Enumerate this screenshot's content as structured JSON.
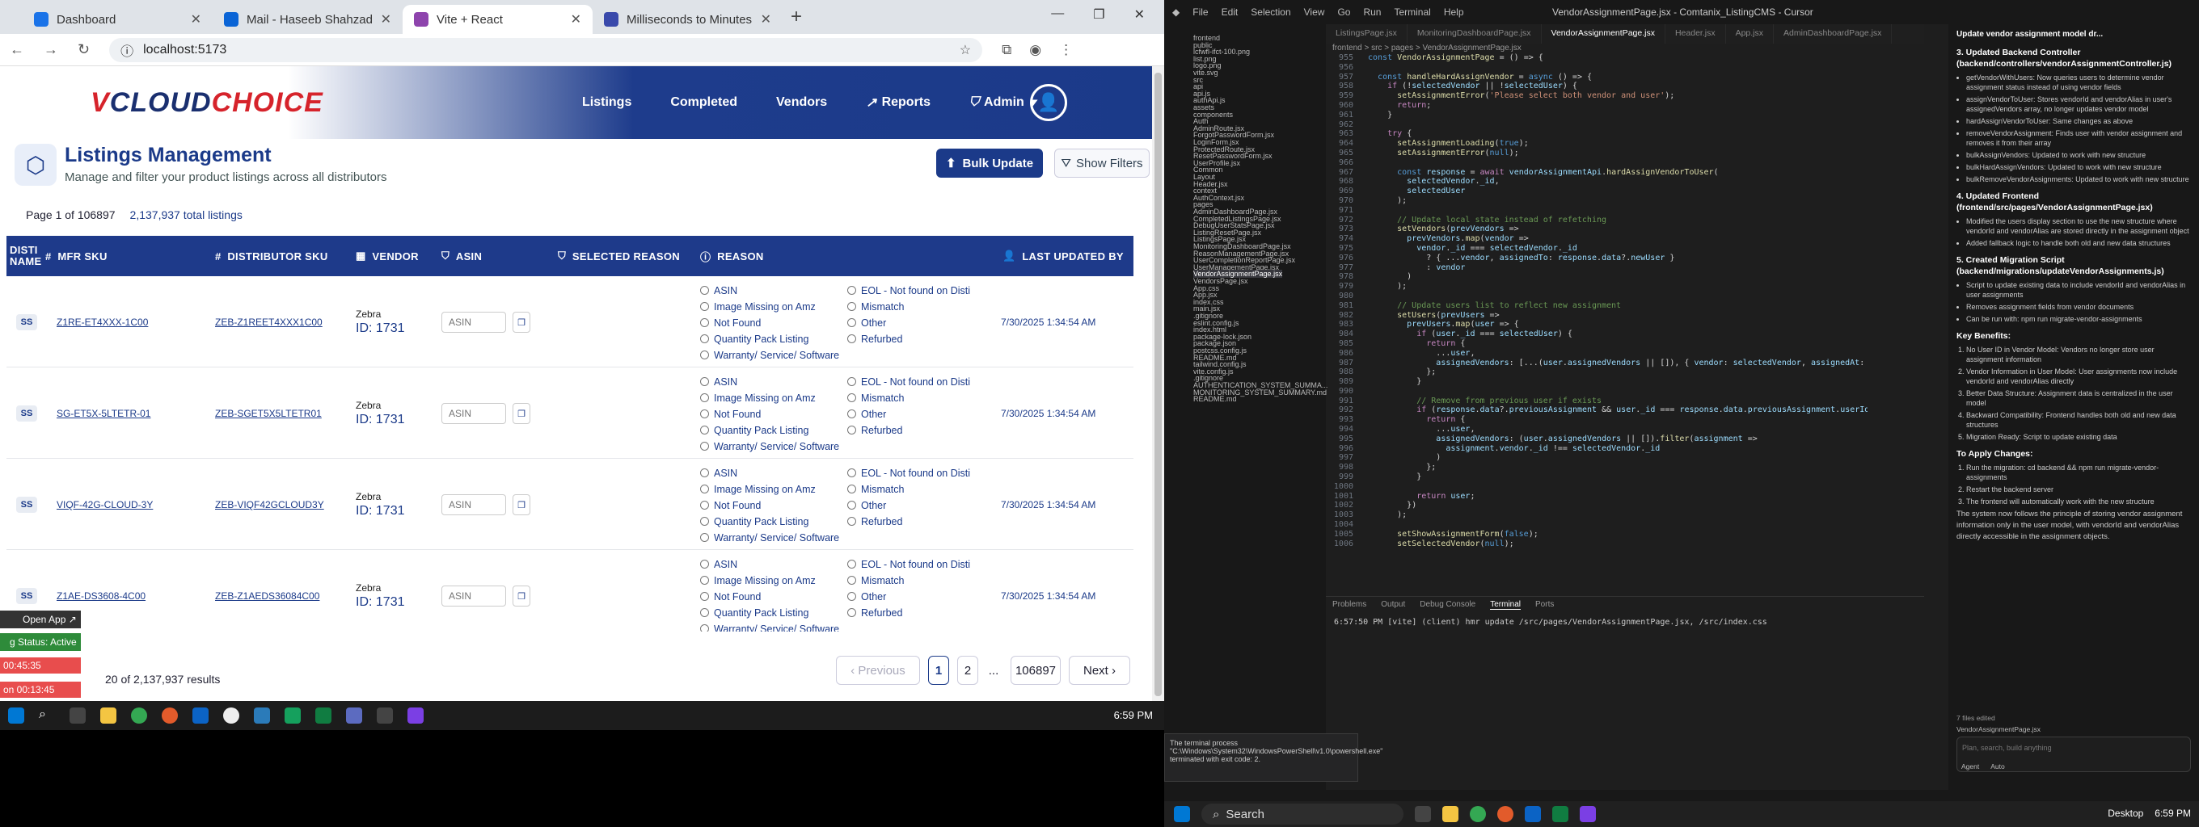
{
  "browser": {
    "tabs": [
      {
        "label": "Dashboard",
        "color": "#1a73e8"
      },
      {
        "label": "Mail - Haseeb Shahzad - Outlo",
        "color": "#0a64d6"
      },
      {
        "label": "Vite + React",
        "color": "#8e44ad"
      },
      {
        "label": "Milliseconds to Minutes | Conv",
        "color": "#3949ab"
      }
    ],
    "url": "localhost:5173"
  },
  "app": {
    "logo_v": "V",
    "logo_cloud": "CLOUD",
    "logo_choice": "CHOICE",
    "nav": [
      "Listings",
      "Completed",
      "Vendors",
      "Reports",
      "Admin"
    ],
    "title": "Listings Management",
    "subtitle": "Manage and filter your product listings across all distributors",
    "bulk_label": "Bulk Update",
    "filters_label": "Show Filters",
    "page_of": "Page 1 of 106897",
    "total": "2,137,937 total listings"
  },
  "table": {
    "headers": [
      "DISTI NAME",
      "MFR SKU",
      "DISTRIBUTOR SKU",
      "VENDOR",
      "ASIN",
      "SELECTED REASON",
      "REASON",
      "LAST UPDATED BY"
    ],
    "reasons_left": [
      "ASIN",
      "Image Missing on Amz",
      "Not Found",
      "Quantity Pack Listing",
      "Warranty/ Service/ Software"
    ],
    "reasons_right": [
      "EOL - Not found on Disti",
      "Mismatch",
      "Other",
      "Refurbed"
    ],
    "asin_placeholder": "ASIN",
    "rows": [
      {
        "disti": "SS",
        "mfr": "Z1RE-ET4XXX-1C00",
        "dsku": "ZEB-Z1REET4XXX1C00",
        "vendor": "Zebra",
        "vid": "ID: 1731",
        "updated": "7/30/2025 1:34:54 AM"
      },
      {
        "disti": "SS",
        "mfr": "SG-ET5X-5LTETR-01",
        "dsku": "ZEB-SGET5X5LTETR01",
        "vendor": "Zebra",
        "vid": "ID: 1731",
        "updated": "7/30/2025 1:34:54 AM"
      },
      {
        "disti": "SS",
        "mfr": "VIQF-42G-CLOUD-3Y",
        "dsku": "ZEB-VIQF42GCLOUD3Y",
        "vendor": "Zebra",
        "vid": "ID: 1731",
        "updated": "7/30/2025 1:34:54 AM"
      },
      {
        "disti": "SS",
        "mfr": "Z1AE-DS3608-4C00",
        "dsku": "ZEB-Z1AEDS36084C00",
        "vendor": "Zebra",
        "vid": "ID: 1731",
        "updated": "7/30/2025 1:34:54 AM"
      }
    ]
  },
  "pagination": {
    "results": "20 of 2,137,937 results",
    "prev": "Previous",
    "pages": [
      "1",
      "2",
      "...",
      "106897"
    ],
    "next": "Next"
  },
  "widgets": {
    "open_app": "Open App",
    "status": "g Status: Active",
    "time1": "00:45:35",
    "time2": "on 00:13:45"
  },
  "taskbar_left": {
    "clock": "6:59 PM"
  },
  "cursor": {
    "title": "VendorAssignmentPage.jsx - Comtanix_ListingCMS - Cursor",
    "menu": [
      "File",
      "Edit",
      "Selection",
      "View",
      "Go",
      "Run",
      "Terminal",
      "Help"
    ],
    "tabs": [
      "ListingsPage.jsx",
      "MonitoringDashboardPage.jsx",
      "VendorAssignmentPage.jsx",
      "Header.jsx",
      "App.jsx",
      "AdminDashboardPage.jsx"
    ],
    "breadcrumb": "frontend > src > pages > VendorAssignmentPage.jsx",
    "explorer_items": [
      "frontend",
      "public",
      "lcfwfl-ifct-100.png",
      "list.png",
      "logo.png",
      "vite.svg",
      "src",
      "api",
      "api.js",
      "authApi.js",
      "assets",
      "components",
      "Auth",
      "AdminRoute.jsx",
      "ForgotPasswordForm.jsx",
      "LoginForm.jsx",
      "ProtectedRoute.jsx",
      "ResetPasswordForm.jsx",
      "UserProfile.jsx",
      "Common",
      "Layout",
      "Header.jsx",
      "context",
      "AuthContext.jsx",
      "pages",
      "AdminDashboardPage.jsx",
      "CompletedListingsPage.jsx",
      "DebugUserStatsPage.jsx",
      "ListingResetPage.jsx",
      "ListingsPage.jsx",
      "MonitoringDashboardPage.jsx",
      "ReasonManagementPage.jsx",
      "UserCompletionReportPage.jsx",
      "UserManagementPage.jsx",
      "VendorAssignmentPage.jsx",
      "VendorsPage.jsx",
      "App.css",
      "App.jsx",
      "index.css",
      "main.jsx",
      ".gitignore",
      "eslint.config.js",
      "index.html",
      "package-lock.json",
      "package.json",
      "postcss.config.js",
      "README.md",
      "tailwind.config.js",
      "vite.config.js",
      ".gitignore",
      "AUTHENTICATION_SYSTEM_SUMMA...",
      "MONITORING_SYSTEM_SUMMARY.md",
      "README.md"
    ],
    "panel_tabs": [
      "Problems",
      "Output",
      "Debug Console",
      "Terminal",
      "Ports"
    ],
    "terminal_line": "6:57:50 PM [vite] (client) hmr update /src/pages/VendorAssignmentPage.jsx, /src/index.css",
    "notif": "The terminal process \"C:\\Windows\\System32\\WindowsPowerShell\\v1.0\\powershell.exe\" terminated with exit code: 2.",
    "search_label": "Search",
    "clock": "6:59 PM",
    "desktop": "Desktop"
  },
  "chat": {
    "header": "Update vendor assignment model dr...",
    "s3": "3. Updated Backend Controller (backend/controllers/vendorAssignmentController.js)",
    "s3_items": [
      "getVendorWithUsers: Now queries users to determine vendor assignment status instead of using vendor fields",
      "assignVendorToUser: Stores vendorId and vendorAlias in user's assignedVendors array, no longer updates vendor model",
      "hardAssignVendorToUser: Same changes as above",
      "removeVendorAssignment: Finds user with vendor assignment and removes it from their array",
      "bulkAssignVendors: Updated to work with new structure",
      "bulkHardAssignVendors: Updated to work with new structure",
      "bulkRemoveVendorAssignments: Updated to work with new structure"
    ],
    "s4": "4. Updated Frontend (frontend/src/pages/VendorAssignmentPage.jsx)",
    "s4_items": [
      "Modified the users display section to use the new structure where vendorId and vendorAlias are stored directly in the assignment object",
      "Added fallback logic to handle both old and new data structures"
    ],
    "s5": "5. Created Migration Script (backend/migrations/updateVendorAssignments.js)",
    "s5_items": [
      "Script to update existing data to include vendorId and vendorAlias in user assignments",
      "Removes assignment fields from vendor documents",
      "Can be run with: npm run migrate-vendor-assignments"
    ],
    "kb": "Key Benefits:",
    "kb_items": [
      "No User ID in Vendor Model: Vendors no longer store user assignment information",
      "Vendor Information in User Model: User assignments now include vendorId and vendorAlias directly",
      "Better Data Structure: Assignment data is centralized in the user model",
      "Backward Compatibility: Frontend handles both old and new data structures",
      "Migration Ready: Script to update existing data"
    ],
    "apply": "To Apply Changes:",
    "apply_items": [
      "Run the migration: cd backend && npm run migrate-vendor-assignments",
      "Restart the backend server",
      "The frontend will automatically work with the new structure"
    ],
    "closing": "The system now follows the principle of storing vendor assignment information only in the user model, with vendorId and vendorAlias directly accessible in the assignment objects.",
    "files_edited": "7 files edited",
    "file": "VendorAssignmentPage.jsx",
    "input_placeholder": "Plan, search, build anything",
    "agent": "Agent",
    "auto": "Auto"
  }
}
